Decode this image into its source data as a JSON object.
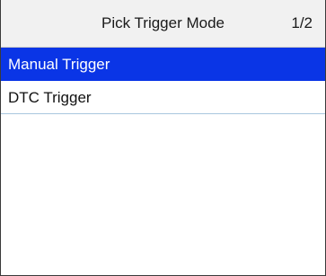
{
  "header": {
    "title": "Pick Trigger Mode",
    "page_indicator": "1/2"
  },
  "list": {
    "selected_index": 0,
    "items": [
      {
        "label": "Manual Trigger"
      },
      {
        "label": "DTC Trigger"
      }
    ]
  },
  "colors": {
    "selected_background": "#0a35e6",
    "selected_text": "#ffffff",
    "header_background": "#f1f1f1",
    "row_divider": "#a9c6de"
  }
}
